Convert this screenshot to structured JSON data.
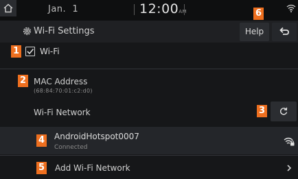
{
  "status_bar": {
    "date": "Jan.  1",
    "time": "12:00",
    "ampm": "AM",
    "home_icon": "home-icon",
    "wifi_icon": "wifi-icon"
  },
  "title_bar": {
    "title": "Wi-Fi Settings",
    "settings_icon": "gear-icon",
    "help_label": "Help",
    "back_icon": "back-arrow-icon"
  },
  "settings": {
    "wifi_toggle": {
      "label": "Wi-Fi",
      "checked": true
    },
    "mac_address": {
      "label": "MAC Address",
      "value": "(68:84:70:01:c2:d0)"
    },
    "network_section": {
      "label": "Wi-Fi Network",
      "refresh_icon": "refresh-icon"
    },
    "connected_network": {
      "name": "AndroidHotspot0007",
      "status": "Connected",
      "signal_icon": "secured-wifi-icon"
    },
    "add_network": {
      "label": "Add Wi-Fi Network",
      "chevron_icon": "chevron-right-icon"
    }
  },
  "callouts": [
    "1",
    "2",
    "3",
    "4",
    "5",
    "6"
  ],
  "colors": {
    "callout": "#ee6f1f",
    "background": "#161719",
    "selected_row": "#24262a",
    "text": "#d0d0d0"
  }
}
